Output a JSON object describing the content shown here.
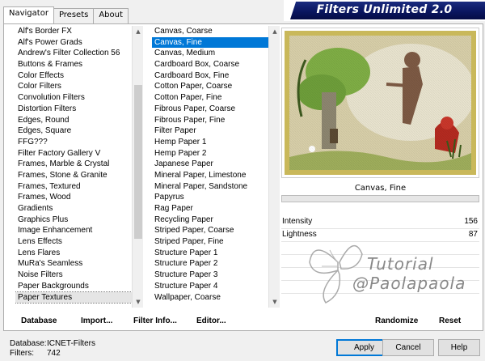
{
  "tabs": [
    {
      "label": "Navigator",
      "active": true
    },
    {
      "label": "Presets",
      "active": false
    },
    {
      "label": "About",
      "active": false
    }
  ],
  "banner_title": "Filters Unlimited 2.0",
  "categories": {
    "selected": "Paper Textures",
    "scroll_position": 0.45,
    "items": [
      "Alf's Border FX",
      "Alf's Power Grads",
      "Andrew's Filter Collection 56",
      "Buttons & Frames",
      "Color Effects",
      "Color Filters",
      "Convolution Filters",
      "Distortion Filters",
      "Edges, Round",
      "Edges, Square",
      "FFG???",
      "Filter Factory Gallery V",
      "Frames, Marble & Crystal",
      "Frames, Stone & Granite",
      "Frames, Textured",
      "Frames, Wood",
      "Gradients",
      "Graphics Plus",
      "Image Enhancement",
      "Lens Effects",
      "Lens Flares",
      "MuRa's Seamless",
      "Noise Filters",
      "Paper Backgrounds",
      "Paper Textures"
    ]
  },
  "filters": {
    "selected": "Canvas, Fine",
    "items": [
      "Canvas, Coarse",
      "Canvas, Fine",
      "Canvas, Medium",
      "Cardboard Box, Coarse",
      "Cardboard Box, Fine",
      "Cotton Paper, Coarse",
      "Cotton Paper, Fine",
      "Fibrous Paper, Coarse",
      "Fibrous Paper, Fine",
      "Filter Paper",
      "Hemp Paper 1",
      "Hemp Paper 2",
      "Japanese Paper",
      "Mineral Paper, Limestone",
      "Mineral Paper, Sandstone",
      "Papyrus",
      "Rag Paper",
      "Recycling Paper",
      "Striped Paper, Coarse",
      "Striped Paper, Fine",
      "Structure Paper 1",
      "Structure Paper 2",
      "Structure Paper 3",
      "Structure Paper 4",
      "Wallpaper, Coarse"
    ]
  },
  "preview": {
    "caption": "Canvas, Fine"
  },
  "sliders": [
    {
      "label": "Intensity",
      "value": "156"
    },
    {
      "label": "Lightness",
      "value": "87"
    }
  ],
  "watermark": {
    "line1": "Tutorial",
    "line2": "@Paolapaola"
  },
  "toolbar": {
    "database": "Database",
    "import": "Import...",
    "filter_info": "Filter Info...",
    "editor": "Editor...",
    "randomize": "Randomize",
    "reset": "Reset"
  },
  "footer": {
    "database_label": "Database:",
    "database_value": "ICNET-Filters",
    "filters_label": "Filters:",
    "filters_value": "742",
    "apply": "Apply",
    "cancel": "Cancel",
    "help": "Help"
  },
  "colors": {
    "selection": "#0078d7",
    "banner": "#0a1660"
  }
}
